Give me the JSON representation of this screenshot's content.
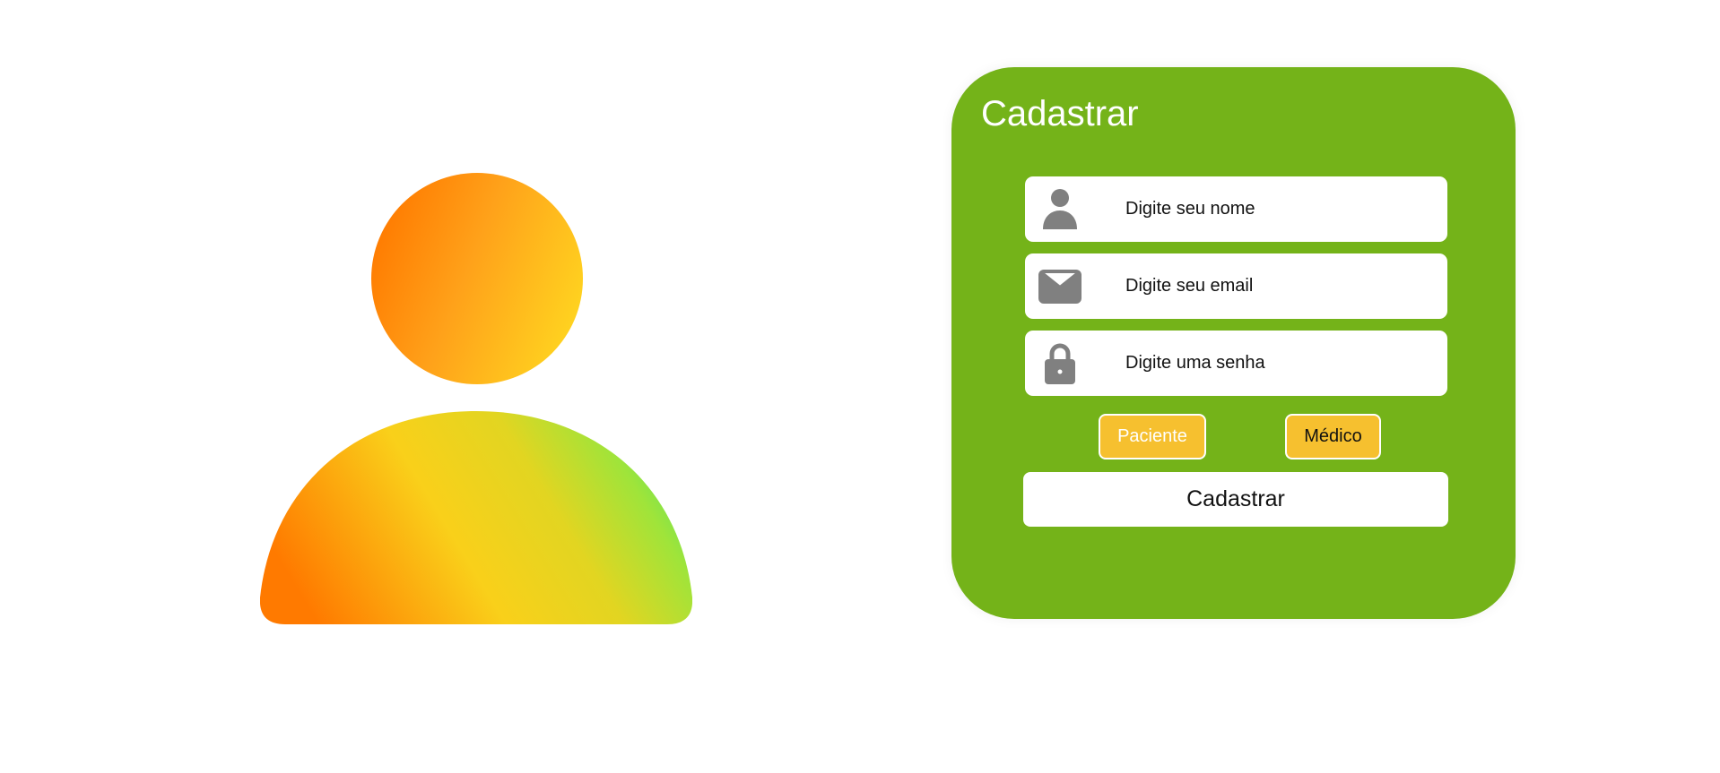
{
  "hero": {
    "icon": "user-avatar-illustration"
  },
  "signup": {
    "title": "Cadastrar",
    "fields": [
      {
        "icon": "user-icon",
        "placeholder": "Digite seu nome",
        "value": ""
      },
      {
        "icon": "envelope-icon",
        "placeholder": "Digite seu email",
        "value": ""
      },
      {
        "icon": "lock-icon",
        "placeholder": "Digite uma senha",
        "value": ""
      }
    ],
    "roles": [
      "Paciente",
      "Médico"
    ],
    "submit_label": "Cadastrar"
  },
  "colors": {
    "card_background": "#74b319",
    "role_button": "#f6c02f",
    "icon_gray": "#808080",
    "gradient_start": "#ff7a00",
    "gradient_mid": "#f9d01a",
    "gradient_end": "#4fe468"
  }
}
